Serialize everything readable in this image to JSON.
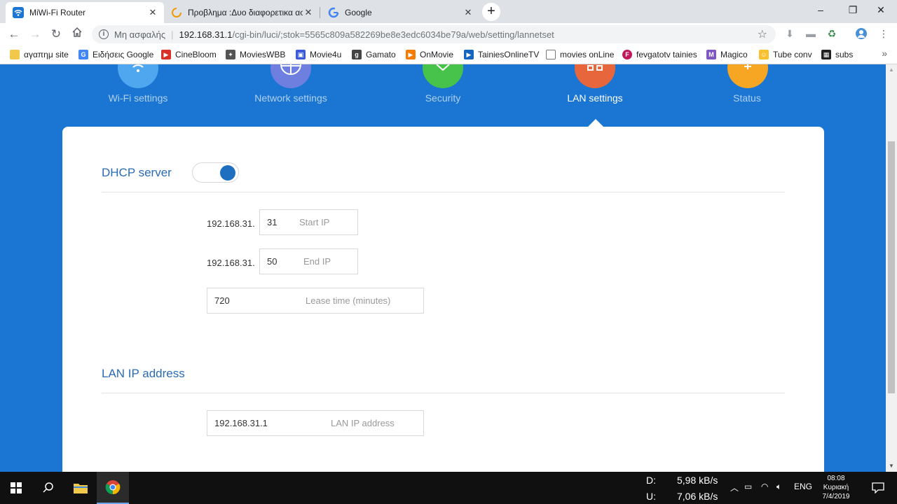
{
  "browser": {
    "tabs": [
      {
        "title": "MiWi-Fi Router",
        "active": true
      },
      {
        "title": "Προβλημα :Δυο διαφορετικα ασ",
        "active": false
      },
      {
        "title": "Google",
        "active": false
      }
    ],
    "address": {
      "security_label": "Μη ασφαλής",
      "host": "192.168.31.1",
      "path": "/cgi-bin/luci/;stok=5565c809a582269be8e3edc6034be79a/web/setting/lannetset"
    },
    "bookmarks": [
      "αγαπημ site",
      "Ειδήσεις Google",
      "CineBloom",
      "MoviesWBB",
      "Movie4u",
      "Gamato",
      "OnMovie",
      "TainiesOnlineTV",
      "movies onLine",
      "fevgatotv tainies",
      "Magico",
      "Tube conv",
      "subs"
    ]
  },
  "router_nav": {
    "items": [
      "Wi-Fi settings",
      "Network settings",
      "Security",
      "LAN settings",
      "Status"
    ],
    "active": "LAN settings",
    "colors": [
      "#4fa8ef",
      "#6f7fe0",
      "#47c24a",
      "#e8663c",
      "#f6a623"
    ]
  },
  "dhcp": {
    "title": "DHCP server",
    "enabled": true,
    "ip_prefix": "192.168.31.",
    "start_ip": {
      "value": "31",
      "label": "Start IP"
    },
    "end_ip": {
      "value": "50",
      "label": "End IP"
    },
    "lease_time": {
      "value": "720",
      "label": "Lease time (minutes)"
    }
  },
  "lan": {
    "title": "LAN IP address",
    "ip": {
      "value": "192.168.31.1",
      "label": "LAN IP address"
    }
  },
  "taskbar": {
    "download_label": "D:",
    "download_speed": "5,98 kB/s",
    "upload_label": "U:",
    "upload_speed": "7,06 kB/s",
    "language": "ENG",
    "time": "08:08",
    "day": "Κυριακή",
    "date": "7/4/2019"
  }
}
